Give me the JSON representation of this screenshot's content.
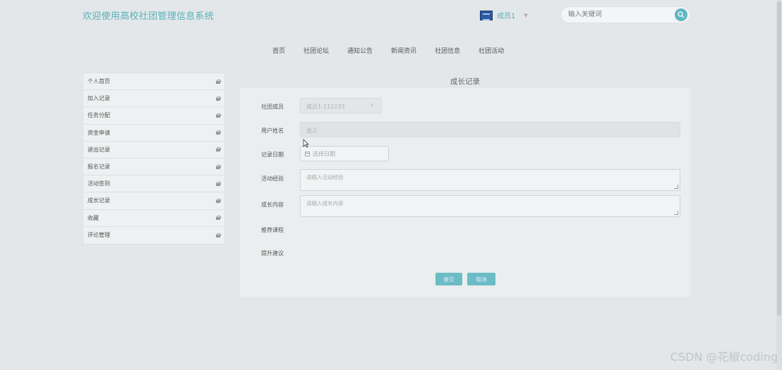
{
  "header": {
    "site_title": "欢迎使用高校社团管理信息系统",
    "user_name": "成员1",
    "search_placeholder": "输入关键词"
  },
  "nav": [
    "首页",
    "社团论坛",
    "通知公告",
    "新闻资讯",
    "社团信息",
    "社团活动"
  ],
  "sidebar": {
    "items": [
      "个人首页",
      "加入记录",
      "任务分配",
      "资金申请",
      "退出记录",
      "报名记录",
      "活动签到",
      "成长记录",
      "收藏",
      "评论管理"
    ]
  },
  "form": {
    "title": "成长记录",
    "fields": {
      "member_label": "社团成员",
      "member_value": "成员1-112233",
      "name_label": "用户姓名",
      "name_value": "张三",
      "date_label": "记录日期",
      "date_placeholder": "选择日期",
      "experience_label": "活动经验",
      "experience_placeholder": "请输入活动经验",
      "growth_label": "成长内容",
      "growth_placeholder": "请输入成长内容",
      "course_label": "推荐课程",
      "advice_label": "提升建议"
    },
    "submit_label": "提交",
    "cancel_label": "取消"
  },
  "watermark": "CSDN @花椒coding",
  "colors": {
    "accent": "#57b1bb",
    "button": "#6bbcc5"
  }
}
